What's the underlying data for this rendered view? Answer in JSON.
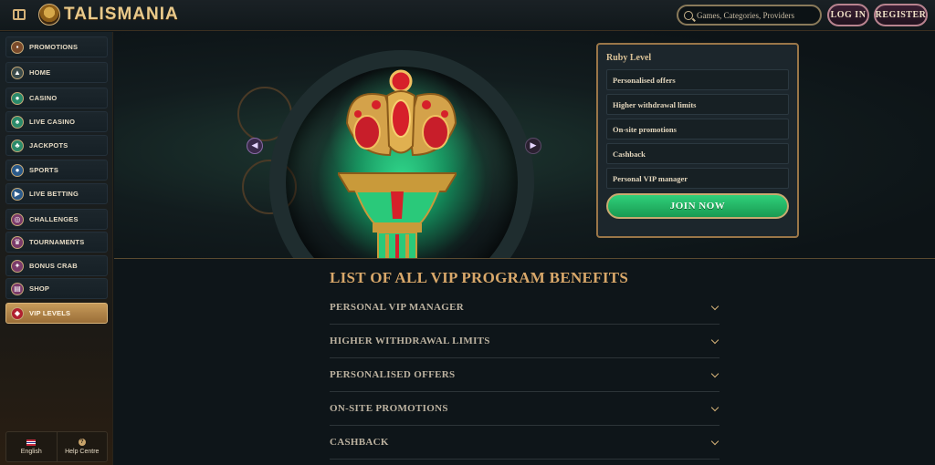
{
  "header": {
    "brand": "TALISMANIA",
    "search_placeholder": "Games, Categories, Providers",
    "login_label": "LOG IN",
    "register_label": "REGISTER"
  },
  "sidebar": {
    "items": [
      {
        "label": "PROMOTIONS",
        "icon": "gift-icon"
      },
      {
        "label": "HOME",
        "icon": "home-icon"
      },
      {
        "label": "CASINO",
        "icon": "slot-icon"
      },
      {
        "label": "LIVE CASINO",
        "icon": "spade-icon"
      },
      {
        "label": "JACKPOTS",
        "icon": "clover-icon"
      },
      {
        "label": "SPORTS",
        "icon": "ball-icon"
      },
      {
        "label": "LIVE BETTING",
        "icon": "tv-icon"
      },
      {
        "label": "CHALLENGES",
        "icon": "target-icon"
      },
      {
        "label": "TOURNAMENTS",
        "icon": "trophy-icon"
      },
      {
        "label": "BONUS CRAB",
        "icon": "crab-icon"
      },
      {
        "label": "SHOP",
        "icon": "shop-icon"
      },
      {
        "label": "VIP LEVELS",
        "icon": "gem-icon"
      }
    ],
    "active_item": "VIP LEVELS",
    "footer": {
      "language_label": "English",
      "help_label": "Help Centre"
    }
  },
  "vip_card": {
    "title": "Ruby Level",
    "perks": [
      "Personalised offers",
      "Higher withdrawal limits",
      "On-site promotions",
      "Cashback",
      "Personal VIP manager"
    ],
    "cta_label": "JOIN NOW"
  },
  "benefits": {
    "title": "LIST OF ALL VIP PROGRAM BENEFITS",
    "items": [
      "PERSONAL VIP MANAGER",
      "HIGHER WITHDRAWAL LIMITS",
      "PERSONALISED OFFERS",
      "ON-SITE PROMOTIONS",
      "CASHBACK"
    ]
  },
  "colors": {
    "accent_gold": "#d9a86a",
    "active_nav": "#c79b5a",
    "cta_green": "#2fd07a",
    "ruby_red": "#d6202a",
    "emerald": "#2fd58a"
  }
}
